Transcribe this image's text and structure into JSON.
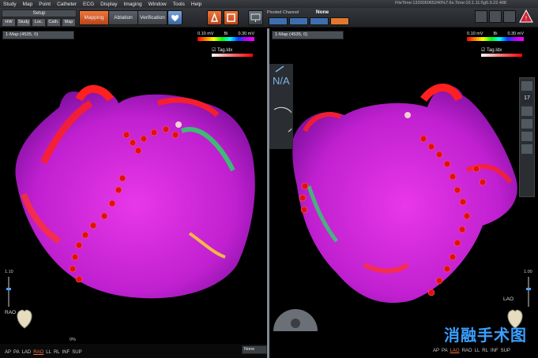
{
  "menu": [
    "Study",
    "Map",
    "Point",
    "Catheter",
    "ECG",
    "Display",
    "Imaging",
    "Window",
    "Tools",
    "Help"
  ],
  "filetime": "FileTime:132005065240%7.6s.Time:10.1.11:5g5.9.22.408",
  "setup": {
    "title": "Setup",
    "buttons": [
      "HW",
      "Study",
      "Loc.",
      "Cath.",
      "Map"
    ]
  },
  "modes": {
    "mapping": "Mapping",
    "ablation": "Ablation",
    "verification": "Verification"
  },
  "pivot": {
    "label": "Pivoted Channel",
    "value": "None"
  },
  "left_pane": {
    "map_label": "1-Map (4535, 0)",
    "scale_min": "0.10 mV",
    "scale_type": "Bi",
    "scale_max": "0.30 mV",
    "tag_label": "Tag.Idx",
    "zoom": "1.10",
    "orientation": "RAO",
    "slider_value": "0%",
    "views": [
      "AP",
      "PA",
      "LAD",
      "RAO",
      "LL",
      "RL",
      "INF",
      "SUP"
    ],
    "active_view": "RAO",
    "none_dropdown": "None"
  },
  "right_pane": {
    "map_label": "1-Map (4535, 0)",
    "scale_min": "0.10 mV",
    "scale_type": "Bi",
    "scale_max": "0.30 mV",
    "tag_label": "Tag.Idx",
    "nav_text": "N/A",
    "zoom": "1.00",
    "orientation": "LAO",
    "side_number": "17",
    "views": [
      "AP",
      "PA",
      "LAO",
      "RAO",
      "LL",
      "RL",
      "INF",
      "SUP"
    ],
    "active_view": "LAO"
  },
  "watermark": "消融手术图",
  "colors": {
    "accent": "#e0782e",
    "blue": "#3d6fb0",
    "magenta": "#e020e0",
    "red": "#ff2020"
  }
}
